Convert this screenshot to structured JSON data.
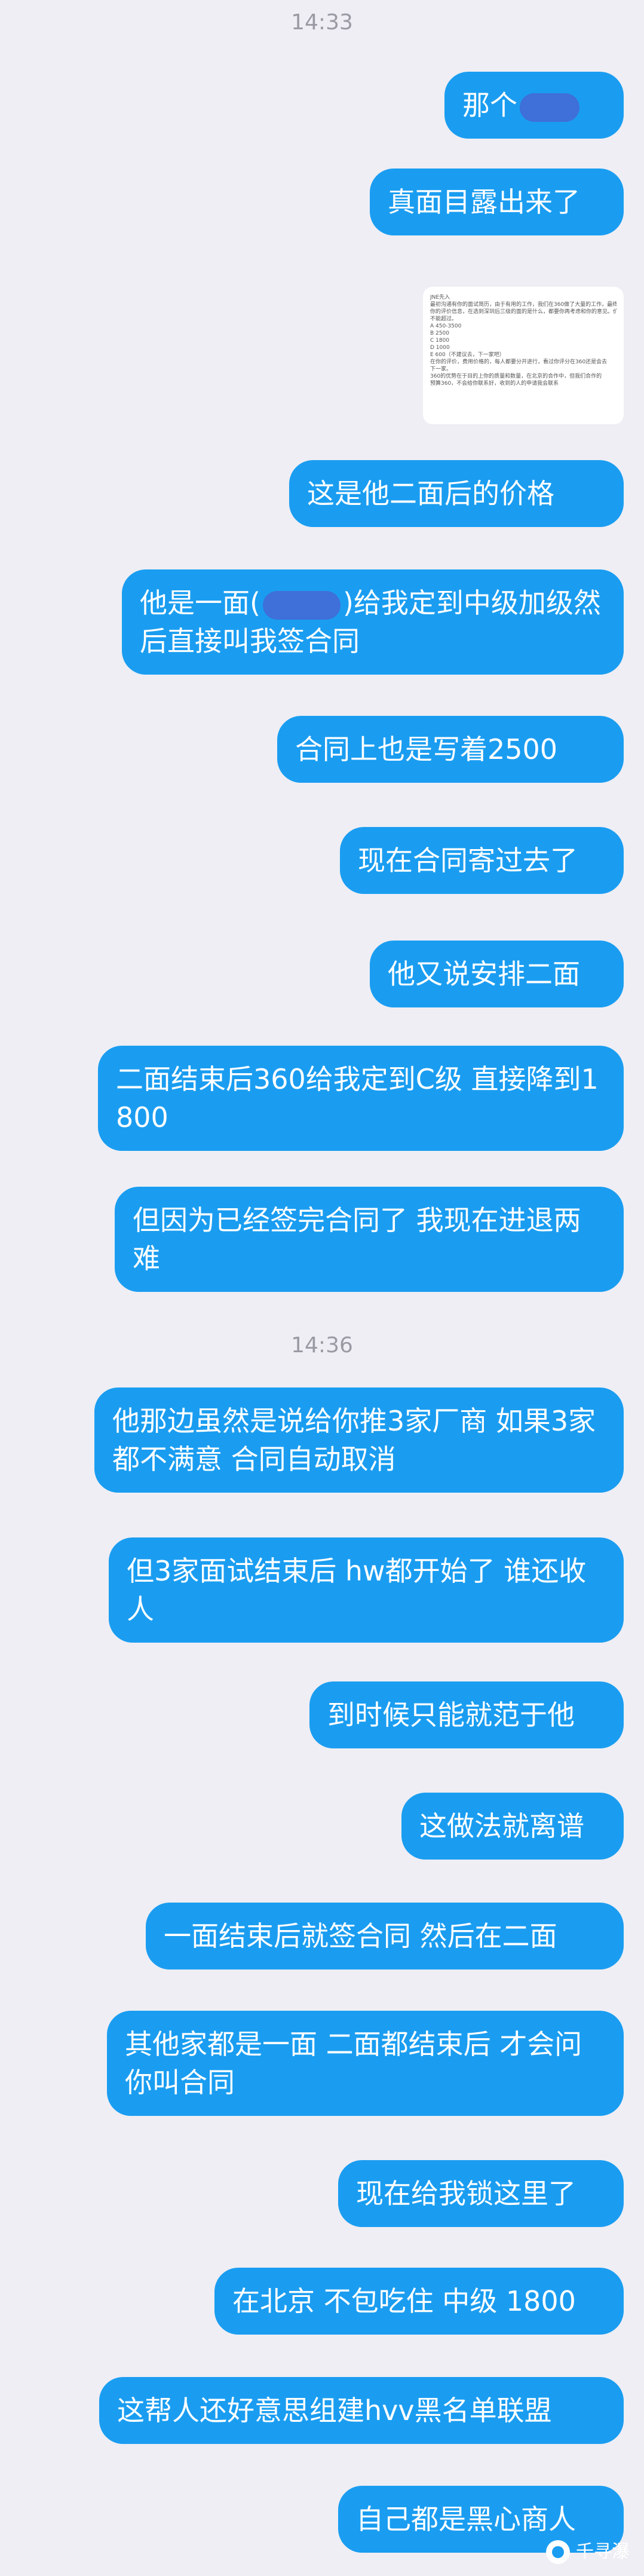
{
  "timestamps": [
    "14:33",
    "14:36"
  ],
  "messages": [
    {
      "prefix": "那个",
      "text": "",
      "redacted": true
    },
    {
      "text": "真面目露出来了"
    },
    {
      "image": true,
      "image_lines": [
        "JNE先入",
        "最初沟通有你的面试简历，由于有用的工作，我们在360做了大量的工作，最终形成了",
        "你的评价信息，在选到深圳后三级的面的是什么，都要你再考虑和你的意见。价格",
        "不能超过。",
        "A 450-3500",
        "B 2500",
        "C 1800",
        "D 1000",
        "E 600（不建议去，下一家吧）",
        "在你的评价，费用价格的，每人都要分开进行，看过你评分在360还是会去",
        "下一家。",
        "360的优势在于目的上你的质量和数量，在北京的合作中，但我们合作的",
        "预算360，不会给你联系好，收到的人的申请我会联系"
      ]
    },
    {
      "text": "这是他二面后的价格"
    },
    {
      "text_before": "他是一面(",
      "text_after": ")给我定到中级加级然后直接叫我签合同",
      "redacted": true
    },
    {
      "text": "合同上也是写着2500"
    },
    {
      "text": "现在合同寄过去了"
    },
    {
      "text": "他又说安排二面"
    },
    {
      "text": "二面结束后360给我定到C级 直接降到1800"
    },
    {
      "text": "但因为已经签完合同了 我现在进退两难"
    },
    {
      "text": "他那边虽然是说给你推3家厂商 如果3家都不满意 合同自动取消"
    },
    {
      "text": "但3家面试结束后 hw都开始了 谁还收人"
    },
    {
      "text": "到时候只能就范于他"
    },
    {
      "text": "这做法就离谱"
    },
    {
      "text": "一面结束后就签合同 然后在二面"
    },
    {
      "text": "其他家都是一面 二面都结束后 才会问你叫合同"
    },
    {
      "text": "现在给我锁这里了"
    },
    {
      "text": "在北京 不包吃住 中级 1800"
    },
    {
      "text": "这帮人还好意思组建hvv黑名单联盟"
    },
    {
      "text": "自己都是黑心商人"
    }
  ],
  "watermark": {
    "text": "千寻瀑"
  },
  "colors": {
    "bubble": "#1a9df1",
    "background": "#eeeef4",
    "timestamp": "#9a9aa4"
  }
}
